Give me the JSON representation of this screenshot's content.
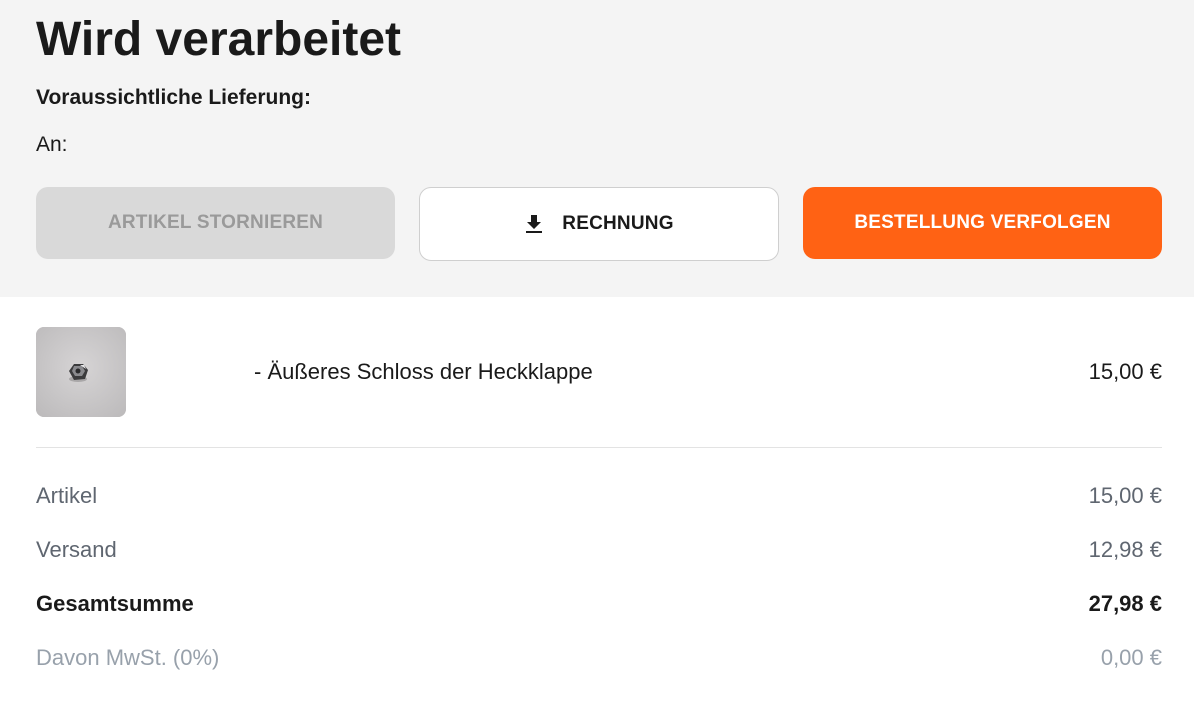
{
  "header": {
    "status_title": "Wird verarbeitet",
    "delivery_label": "Voraussichtliche Lieferung:",
    "recipient_label": "An:"
  },
  "actions": {
    "cancel_label": "ARTIKEL STORNIEREN",
    "invoice_label": "RECHNUNG",
    "invoice_icon": "download-icon",
    "track_label": "BESTELLUNG VERFOLGEN"
  },
  "order_item": {
    "name": "- Äußeres Schloss der Heckklappe",
    "price": "15,00 €"
  },
  "summary": {
    "items_label": "Artikel",
    "items_value": "15,00 €",
    "shipping_label": "Versand",
    "shipping_value": "12,98 €",
    "total_label": "Gesamtsumme",
    "total_value": "27,98 €",
    "tax_label": "Davon MwSt. (0%)",
    "tax_value": "0,00 €"
  },
  "colors": {
    "accent": "#ff6214",
    "header_bg": "#f4f4f4",
    "disabled_bg": "#d9d9d9"
  }
}
